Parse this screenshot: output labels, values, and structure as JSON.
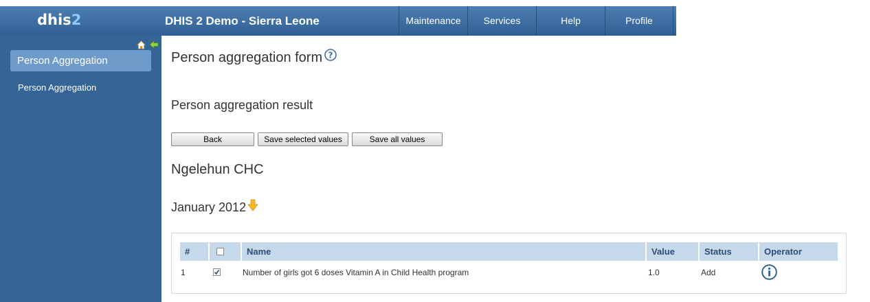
{
  "header": {
    "logo_main": "dhis",
    "logo_accent": "2",
    "app_title": "DHIS 2 Demo - Sierra Leone",
    "menu": [
      "Maintenance",
      "Services",
      "Help",
      "Profile"
    ]
  },
  "sidebar": {
    "section_title": "Person Aggregation",
    "items": [
      {
        "label": "Person Aggregation"
      }
    ]
  },
  "main": {
    "page_title": "Person aggregation form",
    "result_title": "Person aggregation result",
    "buttons": {
      "back": "Back",
      "save_selected": "Save selected values",
      "save_all": "Save all values"
    },
    "org_unit": "Ngelehun CHC",
    "period": "January 2012",
    "table": {
      "columns": [
        "#",
        "",
        "Name",
        "Value",
        "Status",
        "Operator"
      ],
      "header_checkbox_checked": false,
      "rows": [
        {
          "index": "1",
          "checked": true,
          "name": "Number of girls got 6 doses Vitamin A in Child Health program",
          "value": "1.0",
          "status": "Add",
          "operator_icon": "info-icon"
        }
      ]
    }
  },
  "colors": {
    "header_bg": "#356496",
    "sidebar_bg": "#356496",
    "sidebar_header_bg": "#6f9bcb",
    "table_header_bg": "#c5d9ea",
    "table_header_text": "#2b4d7a"
  }
}
